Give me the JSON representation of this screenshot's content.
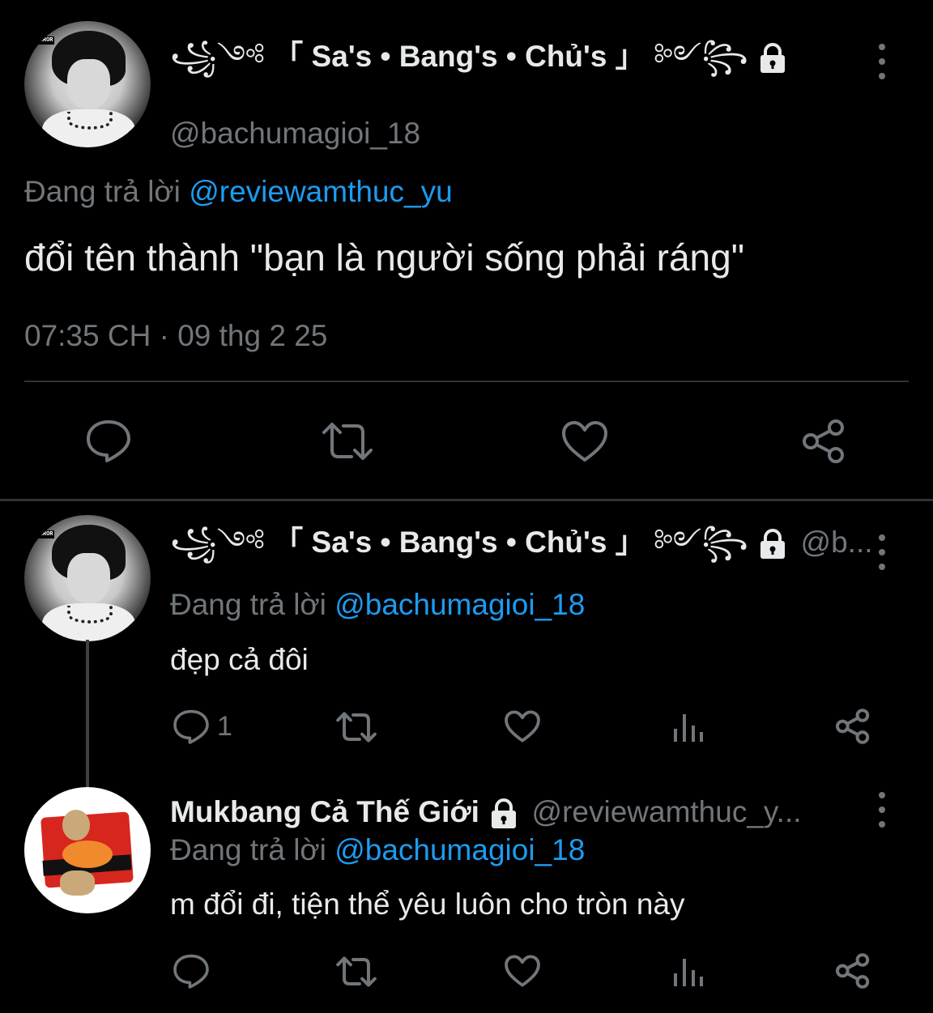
{
  "main_tweet": {
    "author": {
      "display_name": "「 Sa's • Bang's • Chủ's 」",
      "deco_left": "꧁༺",
      "deco_right": "༻꧂",
      "handle": "@bachumagioi_18"
    },
    "replying_prefix": "Đang trả lời",
    "replying_to": "@reviewamthuc_yu",
    "text": "đổi tên thành \"bạn là người sống phải ráng\"",
    "timestamp": "07:35 CH · 09 thg 2 25",
    "actions": [
      "reply-icon",
      "retweet-icon",
      "like-icon",
      "share-icon"
    ]
  },
  "replies": [
    {
      "author": {
        "display_name": "「 Sa's • Bang's • Chủ's 」",
        "deco_left": "꧁༺",
        "deco_right": "༻꧂",
        "handle": "@b..."
      },
      "replying_prefix": "Đang trả lời",
      "replying_to": "@bachumagioi_18",
      "text": "đẹp cả đôi",
      "reply_count": "1",
      "actions": [
        "reply-icon",
        "retweet-icon",
        "like-icon",
        "views-icon",
        "share-icon"
      ]
    },
    {
      "author": {
        "display_name": "Mukbang Cả Thế Giới",
        "handle": "@reviewamthuc_y..."
      },
      "replying_prefix": "Đang trả lời",
      "replying_to": "@bachumagioi_18",
      "text": "m đổi đi, tiện thể yêu luôn cho tròn này",
      "reply_count": "",
      "actions": [
        "reply-icon",
        "retweet-icon",
        "like-icon",
        "views-icon",
        "share-icon"
      ]
    }
  ],
  "colors": {
    "background": "#000000",
    "text": "#e7e9ea",
    "secondary": "#71767b",
    "link": "#1d9bf0",
    "divider": "#2f3336"
  }
}
